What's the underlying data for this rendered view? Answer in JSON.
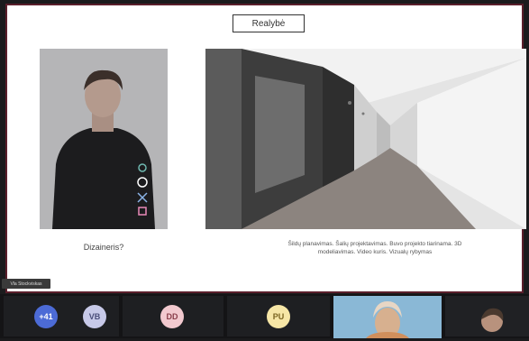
{
  "slide": {
    "title": "Realybė",
    "left_caption": "Dizaineris?",
    "right_caption_line1": "Šildų planavimas. Šalių projektavimas. Buvo projekto tiarinama. 3D",
    "right_caption_line2": "modeliavimas. Video kuris. Vizualų rybymas"
  },
  "speaker_label": "Vla Stockviskas",
  "participants": [
    {
      "initials": "+41",
      "color": "#4c6bd6"
    },
    {
      "initials": "VB",
      "color": "#c7c9e8"
    },
    {
      "initials": "DD",
      "color": "#f2c9cf"
    },
    {
      "initials": "PU",
      "color": "#f6e6a6"
    }
  ],
  "colors": {
    "frame_border": "#5a1f2b",
    "strip_bg": "#141416"
  }
}
